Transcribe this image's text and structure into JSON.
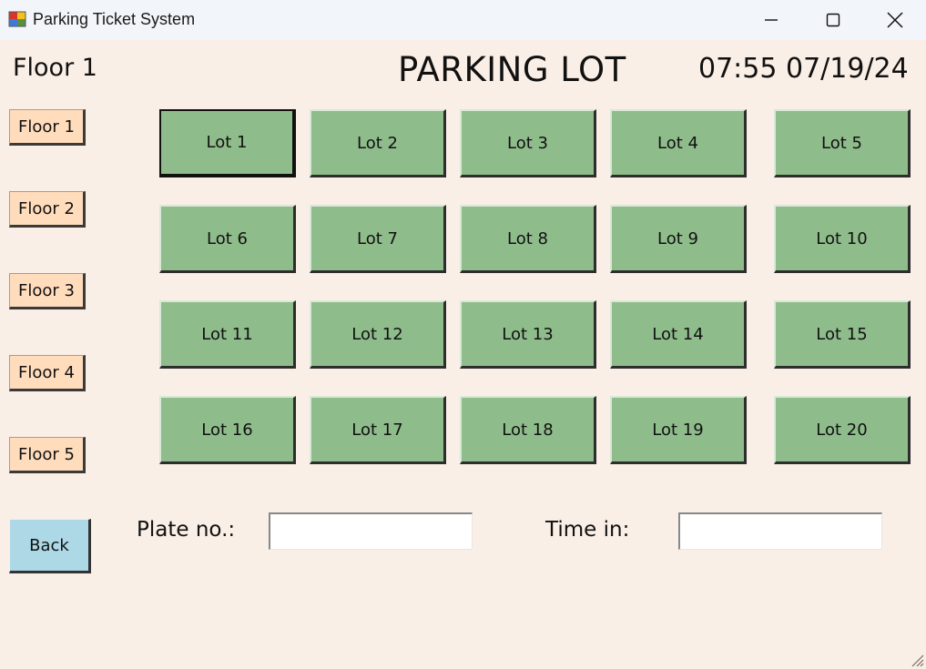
{
  "window": {
    "title": "Parking Ticket System"
  },
  "header": {
    "floor_label": "Floor 1",
    "title": "PARKING LOT",
    "datetime": "07:55 07/19/24"
  },
  "floors": [
    "Floor 1",
    "Floor 2",
    "Floor 3",
    "Floor 4",
    "Floor 5"
  ],
  "lots": [
    "Lot 1",
    "Lot 2",
    "Lot 3",
    "Lot 4",
    "Lot 5",
    "Lot 6",
    "Lot 7",
    "Lot 8",
    "Lot 9",
    "Lot 10",
    "Lot 11",
    "Lot 12",
    "Lot 13",
    "Lot 14",
    "Lot 15",
    "Lot 16",
    "Lot 17",
    "Lot 18",
    "Lot 19",
    "Lot 20"
  ],
  "selected_lot": "Lot 1",
  "back_label": "Back",
  "form": {
    "plate_label": "Plate no.:",
    "plate_value": "",
    "time_label": "Time in:",
    "time_value": ""
  },
  "colors": {
    "background": "#faefe6",
    "lot_button": "#8fbc8b",
    "floor_button": "#ffdcbc",
    "back_button": "#add8e6"
  },
  "icons": {
    "app": "app-window-icon",
    "minimize": "minimize-icon",
    "maximize": "maximize-icon",
    "close": "close-icon",
    "resize": "resize-grip-icon"
  }
}
